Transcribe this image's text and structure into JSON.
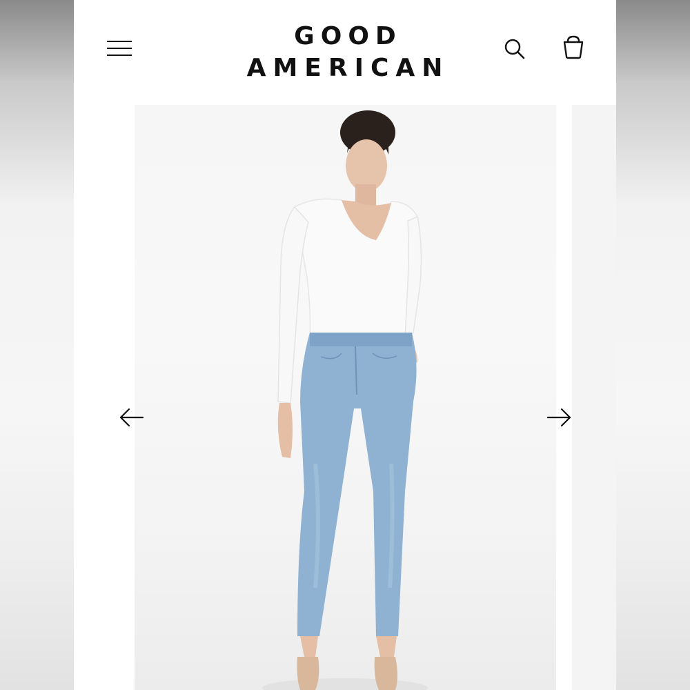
{
  "header": {
    "menu_icon": "hamburger-menu-icon",
    "brand_line1": "GOOD",
    "brand_line2": "AMERICAN",
    "search_icon": "search-icon",
    "cart_icon": "shopping-bag-icon"
  },
  "gallery": {
    "image": "product-photo-model-white-bodysuit-light-blue-skinny-jeans",
    "prev_icon": "arrow-left-icon",
    "next_icon": "arrow-right-icon"
  },
  "colors": {
    "text": "#111111",
    "background": "#ffffff",
    "denim": "#8fb2d3",
    "bodysuit": "#fafafa"
  }
}
